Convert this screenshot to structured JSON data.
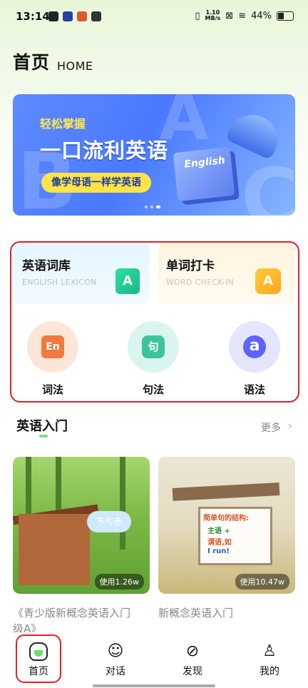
{
  "status": {
    "time": "13:14",
    "net_speed": "1.10",
    "net_unit": "MB/s",
    "battery": "44%"
  },
  "header": {
    "title": "首页",
    "subtitle": "HOME"
  },
  "banner": {
    "small": "轻松掌握",
    "big": "一口流利英语",
    "pill": "像学母语一样学英语",
    "book_label": "English"
  },
  "features": {
    "cards": [
      {
        "title": "英语词库",
        "subtitle": "ENGLISH LEXICON",
        "icon": "A"
      },
      {
        "title": "单词打卡",
        "subtitle": "WORD CHECK-IN",
        "icon": "A"
      }
    ],
    "grammar": [
      {
        "label": "词法",
        "icon": "En"
      },
      {
        "label": "句法",
        "icon": "句"
      },
      {
        "label": "语法",
        "icon": "a"
      }
    ]
  },
  "section": {
    "title": "英语入门",
    "more": "更多"
  },
  "courses": [
    {
      "title": "《青少版新概念英语入门",
      "title2": "级A》",
      "usage": "使用1.26w",
      "cloud_text": "不与赤"
    },
    {
      "title": "新概念英语入门",
      "usage": "使用10.47w",
      "board": [
        "简单句的结构:",
        "主语 +",
        "谓语,如",
        "I run!"
      ]
    }
  ],
  "tabs": [
    {
      "label": "首页"
    },
    {
      "label": "对话"
    },
    {
      "label": "发现"
    },
    {
      "label": "我的"
    }
  ],
  "colors": {
    "highlight": "#e0202a",
    "accent_green": "#7cdf7e",
    "banner_blue": "#4a79ff"
  }
}
